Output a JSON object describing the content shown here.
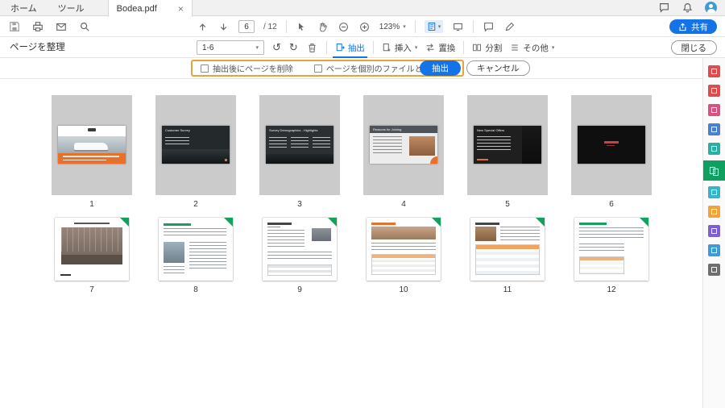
{
  "colors": {
    "accent_blue": "#1473e6",
    "highlight_orange": "#e8a33d",
    "active_green": "#0fa05f",
    "selection_gray": "#cbcbcb",
    "slide_orange": "#e8702a"
  },
  "tab_bar": {
    "home": "ホーム",
    "tools": "ツール",
    "document": "Bodea.pdf",
    "close_glyph": "×"
  },
  "toolbar": {
    "page_current": "6",
    "page_total": "/ 12",
    "zoom": "123%",
    "share": "共有"
  },
  "organize": {
    "title": "ページを整理",
    "range": "1-6",
    "extract": "抽出",
    "insert": "挿入",
    "replace": "置換",
    "split": "分割",
    "more": "その他",
    "close": "閉じる",
    "rotate_left_glyph": "↺",
    "rotate_right_glyph": "↻"
  },
  "options": {
    "delete_after_label": "抽出後にページを削除",
    "separate_files_label": "ページを個別のファイルとして抽出",
    "extract_button": "抽出",
    "cancel_button": "キャンセル"
  },
  "sidebar_tools": [
    {
      "name": "export-pdf",
      "color": "#e04c4c"
    },
    {
      "name": "create-pdf",
      "color": "#e04c4c"
    },
    {
      "name": "edit-pdf",
      "color": "#d9517e"
    },
    {
      "name": "comment",
      "color": "#4a7fd4"
    },
    {
      "name": "combine-files",
      "color": "#28b0a2"
    },
    {
      "name": "organize-pages",
      "color": "#0fa05f"
    },
    {
      "name": "compress-pdf",
      "color": "#35b5c9"
    },
    {
      "name": "fill-and-sign",
      "color": "#f2a33c"
    },
    {
      "name": "protect",
      "color": "#7e5fd6"
    },
    {
      "name": "prepare-form",
      "color": "#3f9bd8"
    },
    {
      "name": "more-tools",
      "color": "#6e6e6e"
    }
  ],
  "pages": [
    {
      "num": "1",
      "title": ""
    },
    {
      "num": "2",
      "title": "Customer Survey"
    },
    {
      "num": "3",
      "title": "Survey Demographics - Highlights"
    },
    {
      "num": "4",
      "title": "Reasons for Joining"
    },
    {
      "num": "5",
      "title": "New Special Offers"
    },
    {
      "num": "6",
      "title": ""
    },
    {
      "num": "7",
      "title": ""
    },
    {
      "num": "8",
      "title": ""
    },
    {
      "num": "9",
      "title": ""
    },
    {
      "num": "10",
      "title": ""
    },
    {
      "num": "11",
      "title": ""
    },
    {
      "num": "12",
      "title": ""
    }
  ]
}
